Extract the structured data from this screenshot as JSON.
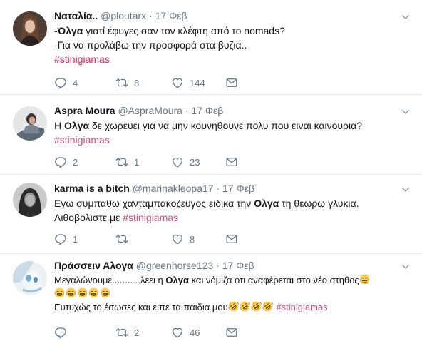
{
  "tweets": [
    {
      "name": "Ναταλία..",
      "handle": "@ploutarx",
      "dot": "·",
      "date": "17 Φεβ",
      "line1_prefix": "-",
      "line1_name": "Όλγα",
      "line1_rest": " γιατί έφυγες σαν τον κλέφτη από το nomads?",
      "line2": "-Για να προλάβω την προσφορά στα βυζια..",
      "hashtag": "#stinigiamas",
      "replies": "4",
      "retweets": "8",
      "likes": "144"
    },
    {
      "name": "Aspra Moura",
      "handle": "@AspraMoura",
      "dot": "·",
      "date": "17 Φεβ",
      "line1_prefix": "Η ",
      "line1_name": "Ολγα",
      "line1_rest": " δε χωρευει για να μην κουνηθουνε πολυ που ειναι καινουρια?",
      "hashtag": "#stinigiamas",
      "replies": "2",
      "retweets": "1",
      "likes": "23"
    },
    {
      "name": "karma is a bitch",
      "handle": "@marinakleopa17",
      "dot": "·",
      "date": "17 Φεβ",
      "line1_prefix": "Εγω συμπαθω χανταμπακοζευγος ειδικα την ",
      "line1_name": "Ολγα",
      "line1_rest": " τη θεωρω γλυκια.",
      "line2_prefix": "Λιθοβολιστε με ",
      "hashtag": "#stinigiamas",
      "replies": "1",
      "retweets": "",
      "likes": "8"
    },
    {
      "name": "Πράσσειν Αλογα",
      "handle": "@greenhorse123",
      "dot": "·",
      "date": "17 Φεβ",
      "line1_prefix": "Μεγαλώνουμε...........λεει η ",
      "line1_name": "Ολγα",
      "line1_rest": " και νόμιζα οτι αναφέρεται στο νέο στηθος",
      "line3_prefix": "Ευτυχώς το έσωσες και ειπε τα παιδια μου",
      "hashtag": "#stinigiamas",
      "replies": "",
      "retweets": "2",
      "likes": "46"
    }
  ],
  "icons": [
    "reply-icon",
    "retweet-icon",
    "like-icon",
    "dm-icon",
    "chevron-down-icon",
    "tears-of-joy-emoji",
    "rofl-emoji"
  ],
  "colors": {
    "hashtag": "#e0245e",
    "meta": "#657786",
    "divider": "#e6ecf0"
  }
}
